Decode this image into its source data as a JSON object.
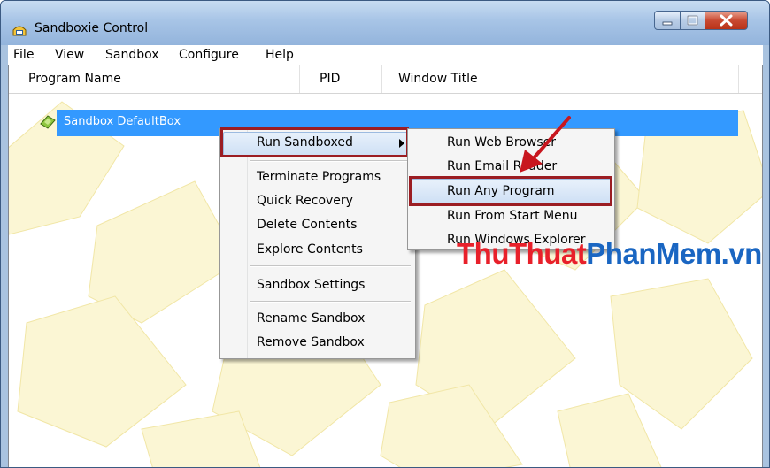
{
  "window": {
    "title": "Sandboxie Control",
    "app_icon": "sandboxie-icon",
    "controls": [
      "minimize-icon",
      "maximize-icon",
      "close-icon"
    ]
  },
  "menubar": {
    "items": [
      "File",
      "View",
      "Sandbox",
      "Configure",
      "Help"
    ]
  },
  "list": {
    "columns": [
      "Program Name",
      "PID",
      "Window Title"
    ],
    "rows": [
      {
        "label": "Sandbox DefaultBox",
        "icon": "sandbox-icon",
        "selected": true
      }
    ]
  },
  "context_menu": {
    "items": [
      "Run Sandboxed",
      "Terminate Programs",
      "Quick Recovery",
      "Delete Contents",
      "Explore Contents",
      "Sandbox Settings",
      "Rename Sandbox",
      "Remove Sandbox"
    ],
    "active": "Run Sandboxed"
  },
  "submenu": {
    "items": [
      "Run Web Browser",
      "Run Email Reader",
      "Run Any Program",
      "Run From Start Menu",
      "Run Windows Explorer"
    ],
    "highlighted": "Run Any Program"
  },
  "watermark": {
    "part1": "ThuThuat",
    "part2": "PhanMem.vn"
  },
  "colors": {
    "selection": "#3399ff",
    "highlight_box": "#9b1d23",
    "watermark_red": "#e8202a",
    "watermark_blue": "#1a66c2",
    "arrow": "#c8161e"
  }
}
